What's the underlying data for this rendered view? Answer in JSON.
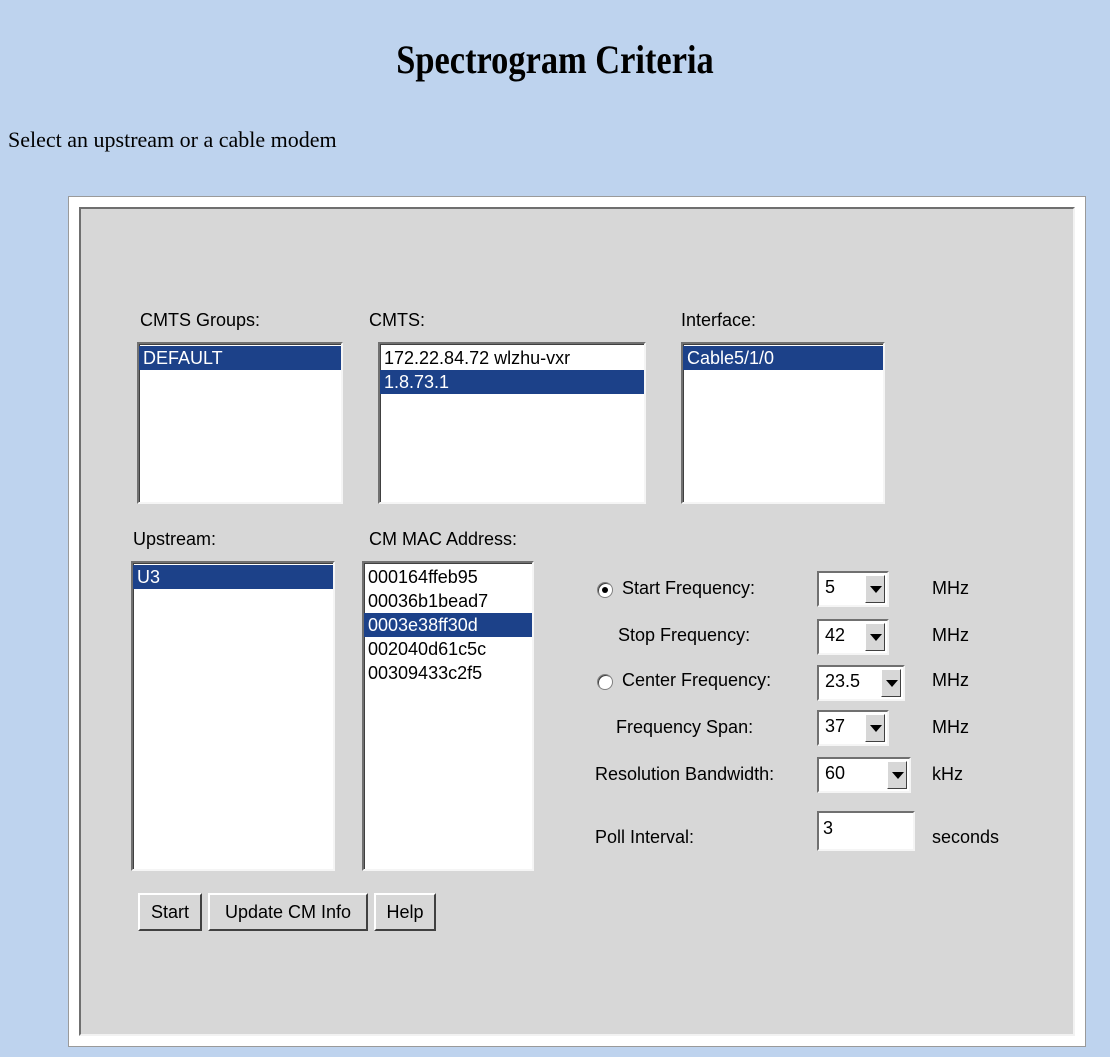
{
  "page": {
    "title": "Spectrogram Criteria",
    "instructions": "Select an upstream or a cable modem"
  },
  "lists": {
    "cmts_groups": {
      "label": "CMTS Groups:",
      "items": [
        "DEFAULT"
      ],
      "selected": 0
    },
    "cmts": {
      "label": "CMTS:",
      "items": [
        "172.22.84.72 wlzhu-vxr",
        "1.8.73.1"
      ],
      "selected": 1
    },
    "interface": {
      "label": "Interface:",
      "items": [
        "Cable5/1/0"
      ],
      "selected": 0
    },
    "upstream": {
      "label": "Upstream:",
      "items": [
        "U3"
      ],
      "selected": 0
    },
    "cm_mac": {
      "label": "CM MAC Address:",
      "items": [
        "000164ffeb95",
        "00036b1bead7",
        "0003e38ff30d",
        "002040d61c5c",
        "00309433c2f5"
      ],
      "selected": 2
    }
  },
  "frequency": {
    "mode": "start",
    "start_label": "Start Frequency:",
    "start_value": "5",
    "stop_label": "Stop Frequency:",
    "stop_value": "42",
    "center_label": "Center Frequency:",
    "center_value": "23.5",
    "span_label": "Frequency Span:",
    "span_value": "37",
    "rbw_label": "Resolution Bandwidth:",
    "rbw_value": "60",
    "unit_mhz": "MHz",
    "unit_khz": "kHz"
  },
  "poll": {
    "label": "Poll Interval:",
    "value": "3",
    "unit": "seconds"
  },
  "buttons": {
    "start": "Start",
    "update": "Update CM Info",
    "help": "Help"
  },
  "colors": {
    "background": "#bed3ee",
    "panel": "#d7d7d7",
    "selection": "#1c4189"
  }
}
